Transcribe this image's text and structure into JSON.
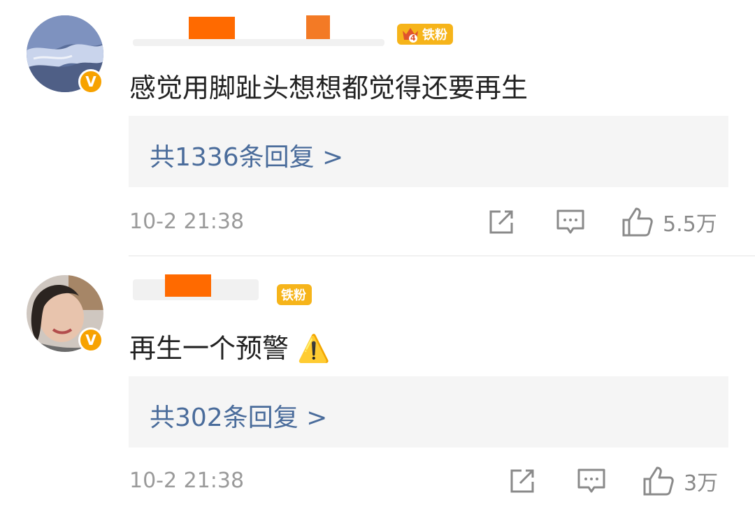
{
  "comments": [
    {
      "avatar_icon": "ocean-avatar-icon",
      "fan_badge": {
        "level": "4",
        "label": "铁粉"
      },
      "text": "感觉用脚趾头想想都觉得还要再生",
      "replies_label": "共1336条回复 >",
      "time": "10-2 21:38",
      "likes": "5.5万"
    },
    {
      "avatar_icon": "portrait-avatar-icon",
      "fan_badge": {
        "label": "铁粉"
      },
      "text": "再生一个预警 ⚠️",
      "replies_label": "共302条回复 >",
      "time": "10-2 21:38",
      "likes": "3万"
    }
  ],
  "colors": {
    "link": "#4a6c9b",
    "meta": "#9a9a9a",
    "badge": "#f6b41a",
    "verified": "#f7a200",
    "redaction": "#ff6a00"
  }
}
